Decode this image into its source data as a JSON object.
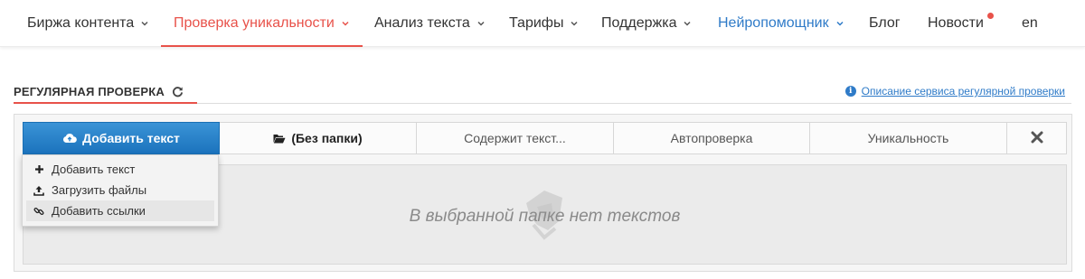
{
  "colors": {
    "accent_red": "#e8524a",
    "link_blue": "#2f7bc8",
    "button_blue": "#2a84cb"
  },
  "nav": {
    "items": [
      {
        "label": "Биржа контента",
        "has_chevron": true
      },
      {
        "label": "Проверка уникальности",
        "has_chevron": true,
        "active": true
      },
      {
        "label": "Анализ текста",
        "has_chevron": true
      },
      {
        "label": "Тарифы",
        "has_chevron": true
      },
      {
        "label": "Поддержка",
        "has_chevron": true
      },
      {
        "label": "Нейропомощник",
        "has_chevron": true,
        "highlight": "blue"
      },
      {
        "label": "Блог",
        "has_chevron": false
      },
      {
        "label": "Новости",
        "has_chevron": false,
        "badge": true
      },
      {
        "label": "en",
        "has_chevron": false
      }
    ]
  },
  "section": {
    "title": "РЕГУЛЯРНАЯ ПРОВЕРКА",
    "help_link": "Описание сервиса регулярной проверки",
    "icons": {
      "refresh": "refresh-icon",
      "info": "info-icon"
    }
  },
  "toolbar": {
    "add_text": "Добавить текст",
    "folder": "(Без папки)",
    "contains_text": "Содержит текст...",
    "autocheck": "Автопроверка",
    "uniqueness": "Уникальность",
    "icons": {
      "add": "cloud-upload-icon",
      "folder": "folder-open-icon",
      "close": "close-icon"
    }
  },
  "dropdown": {
    "items": [
      {
        "label": "Добавить текст",
        "icon": "plus-icon"
      },
      {
        "label": "Загрузить файлы",
        "icon": "upload-icon"
      },
      {
        "label": "Добавить ссылки",
        "icon": "link-icon",
        "hovered": true
      }
    ]
  },
  "empty_state": {
    "message": "В выбранной папке нет текстов"
  }
}
